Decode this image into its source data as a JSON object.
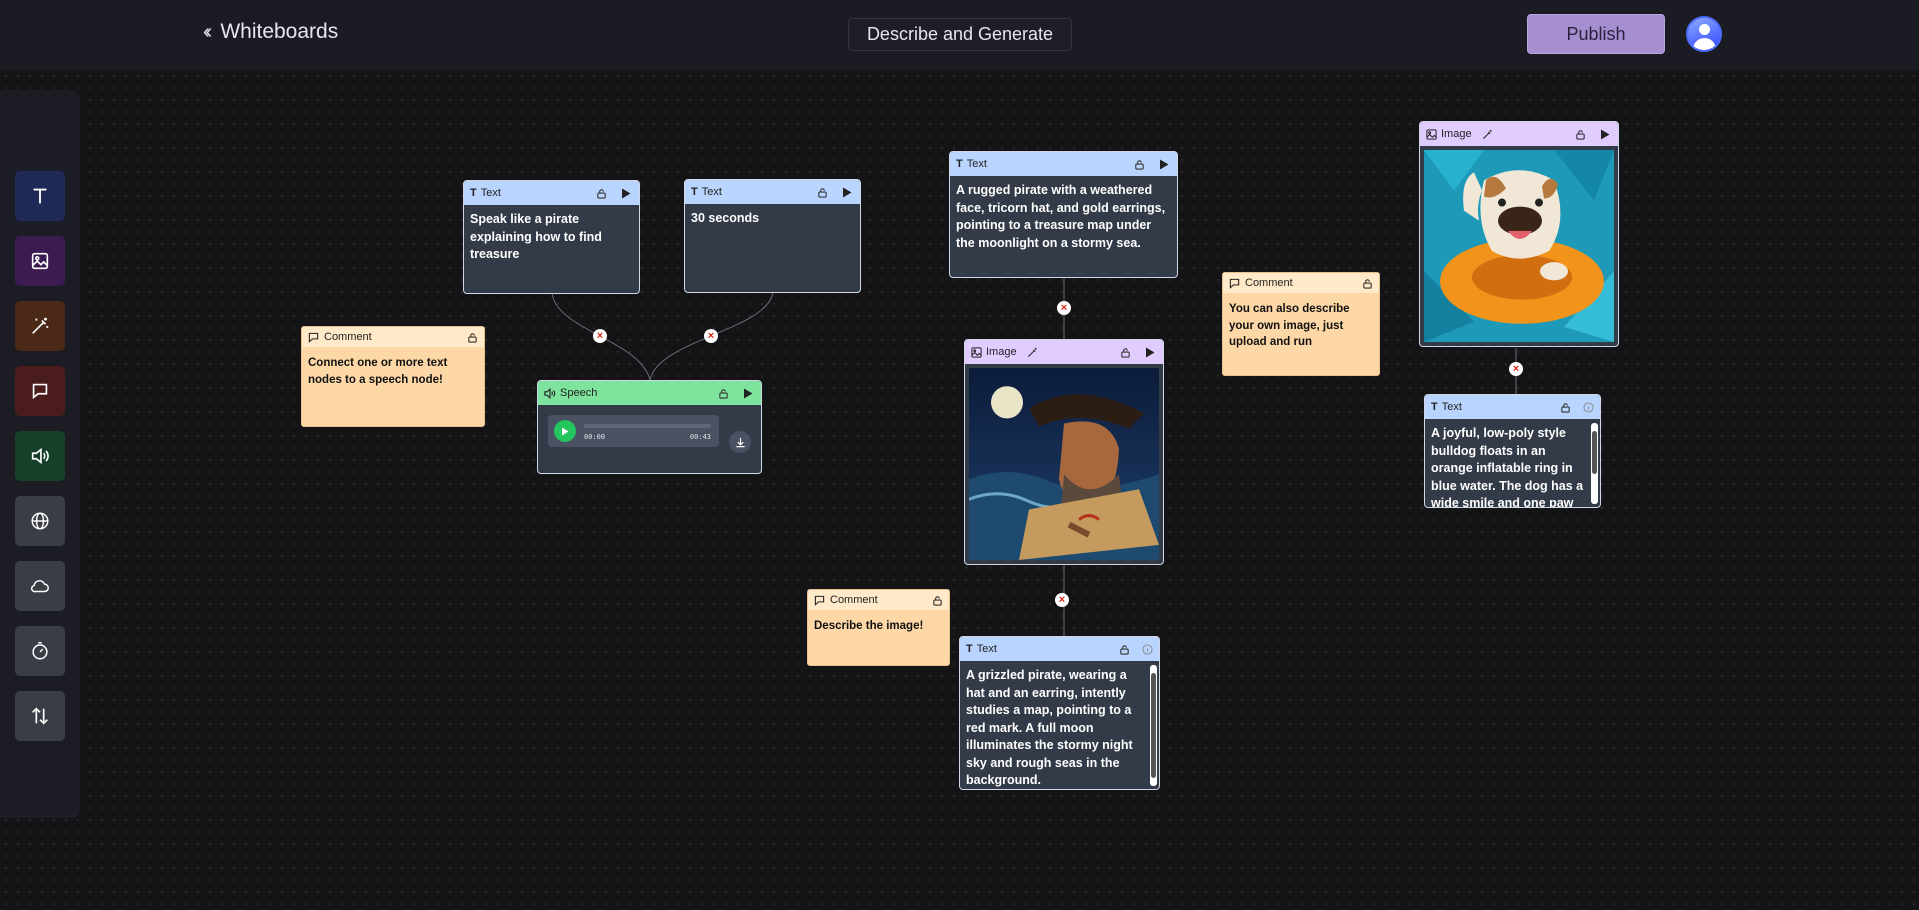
{
  "header": {
    "back_label": "Whiteboards",
    "board_title": "Describe and Generate",
    "publish_label": "Publish"
  },
  "toolbar": {
    "tools": [
      {
        "name": "text-tool",
        "icon": "text-icon",
        "color": "#1e2a55"
      },
      {
        "name": "image-tool",
        "icon": "image-icon",
        "color": "#3c1a52"
      },
      {
        "name": "magic-tool",
        "icon": "magic-wand-icon",
        "color": "#4a2a16"
      },
      {
        "name": "comment-tool",
        "icon": "comment-icon",
        "color": "#4a1c1c"
      },
      {
        "name": "speech-tool",
        "icon": "speaker-icon",
        "color": "#16402a"
      },
      {
        "name": "web-tool",
        "icon": "globe-icon",
        "color": "#3a3d45"
      },
      {
        "name": "cloud-tool",
        "icon": "cloud-icon",
        "color": "#3a3d45"
      },
      {
        "name": "timer-tool",
        "icon": "stopwatch-icon",
        "color": "#3a3d45"
      },
      {
        "name": "sort-tool",
        "icon": "sort-icon",
        "color": "#3a3d45"
      }
    ]
  },
  "nodes": {
    "text_pirate_prompt": {
      "type": "Text",
      "body": "Speak like a pirate explaining how to find treasure"
    },
    "text_duration": {
      "type": "Text",
      "body": "30 seconds"
    },
    "speech": {
      "type": "Speech",
      "time_start": "00:00",
      "time_end": "00:43"
    },
    "comment_speech": {
      "type": "Comment",
      "body": "Connect one or more text nodes to a speech node!"
    },
    "text_pirate_desc": {
      "type": "Text",
      "body": "A rugged pirate with a weathered face, tricorn hat, and gold earrings, pointing to a treasure map under the moonlight on a stormy sea."
    },
    "image_pirate": {
      "type": "Image"
    },
    "comment_describe": {
      "type": "Comment",
      "body": "Describe the image!"
    },
    "text_pirate_caption": {
      "type": "Text",
      "body": "A grizzled pirate, wearing a hat and an earring, intently studies a map, pointing to a red mark. A full moon illuminates the stormy night sky and rough seas in the background."
    },
    "comment_upload": {
      "type": "Comment",
      "body": "You can also describe your own image, just upload and run"
    },
    "image_bulldog": {
      "type": "Image"
    },
    "text_bulldog_caption": {
      "type": "Text",
      "body": "A joyful, low-poly style bulldog floats in an orange inflatable ring in blue water. The dog has a wide smile and one paw raised."
    }
  }
}
